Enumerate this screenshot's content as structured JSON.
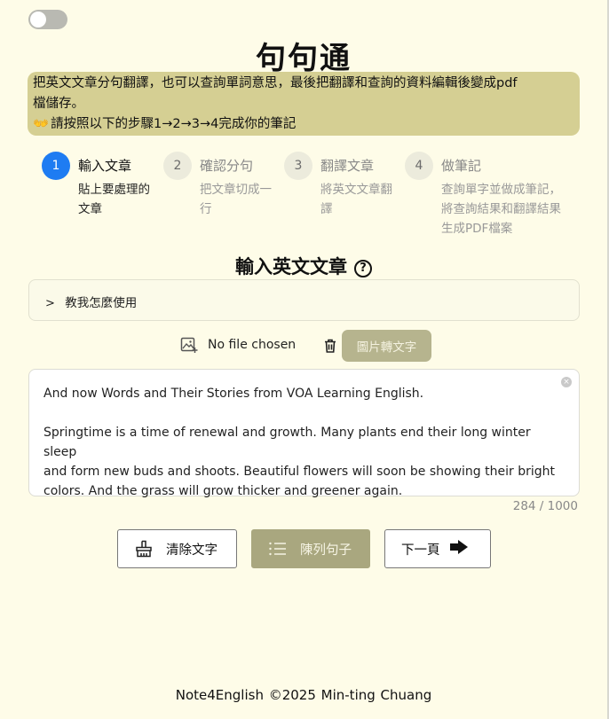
{
  "app": {
    "title": "句句通",
    "intro_line1": "把英文文章分句翻譯，也可以查詢單詞意思，最後把翻譯和查詢的資料編輯後變成pdf",
    "intro_line2": "檔儲存。",
    "intro_hands": "👐",
    "intro_line3": "請按照以下的步驟1→2→3→4完成你的筆記"
  },
  "steps": [
    {
      "num": "1",
      "title": "輸入文章",
      "desc1": "貼上要處理的",
      "desc2": "文章",
      "desc3": ""
    },
    {
      "num": "2",
      "title": "確認分句",
      "desc1": "把文章切成一",
      "desc2": "行",
      "desc3": ""
    },
    {
      "num": "3",
      "title": "翻譯文章",
      "desc1": "將英文文章翻",
      "desc2": "譯",
      "desc3": ""
    },
    {
      "num": "4",
      "title": "做筆記",
      "desc1": "查詢單字並做成筆記，",
      "desc2": "將查詢結果和翻譯結果",
      "desc3": "生成PDF檔案"
    }
  ],
  "section": {
    "title": "輸入英文文章",
    "help_icon": "?"
  },
  "accordion": {
    "chevron": ">",
    "label": "教我怎麼使用"
  },
  "upload": {
    "file_label": "No file chosen",
    "ocr_button": "圖片轉文字"
  },
  "editor": {
    "line1": "And now Words and Their Stories from VOA Learning English.",
    "para2_line1": "Springtime is a time of renewal and growth. Many plants end their long winter sleep",
    "para2_line2": "and form new buds and shoots. Beautiful flowers will soon be showing their bright",
    "para2_line3": "colors. And the grass will grow thicker and greener again.",
    "clear_icon": "×",
    "counter": "284 / 1000"
  },
  "buttons": {
    "clear": "清除文字",
    "list": "陳列句子",
    "next": "下一頁"
  },
  "footer": {
    "text": "Note4English  ©2025  Min-ting Chuang"
  },
  "colors": {
    "background": "#fefce8",
    "banner": "#d5cf93",
    "active_step": "#1e7cf2",
    "primary_button": "#a9a77f"
  }
}
